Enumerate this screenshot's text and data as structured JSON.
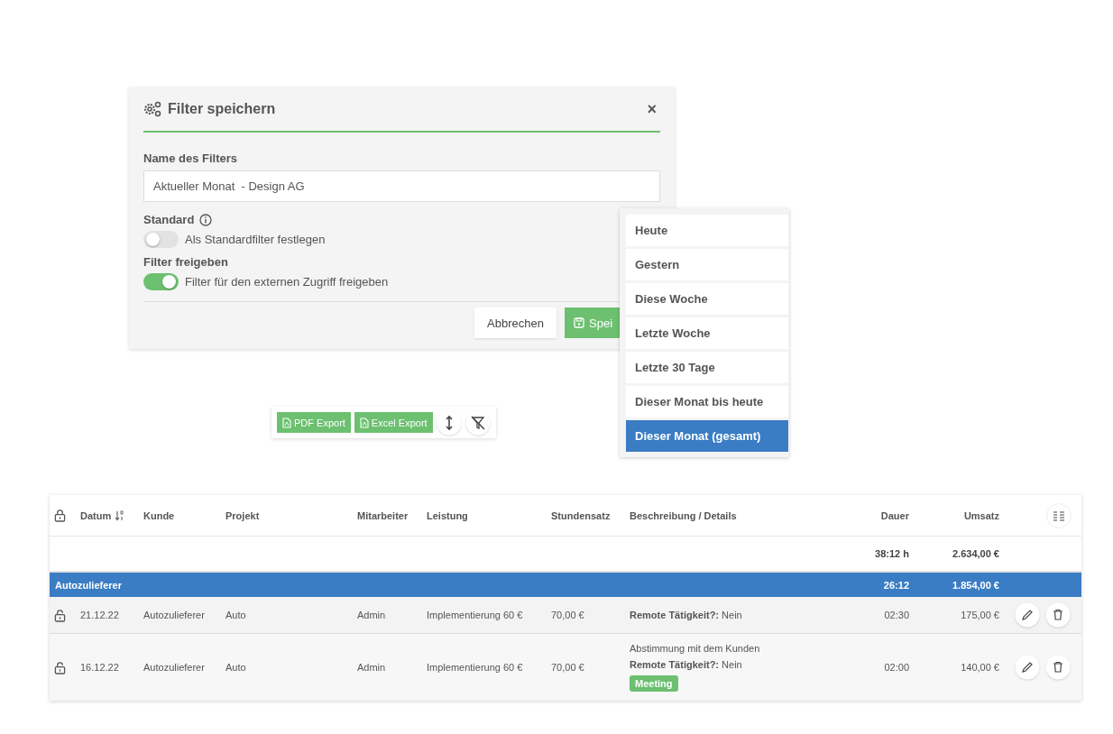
{
  "dialog": {
    "title": "Filter speichern",
    "close": "×",
    "name_label": "Name des Filters",
    "name_value": "Aktueller Monat  - Design AG",
    "toggles": [
      {
        "label": "Standard",
        "info": true,
        "text": "Als Standardfilter festlegen",
        "on": false
      },
      {
        "label": "Filter freigeben",
        "info": false,
        "text": "Filter für den externen Zugriff freigeben",
        "on": true
      }
    ],
    "cancel": "Abbrechen",
    "save": "Spei"
  },
  "period_menu": [
    {
      "label": "Heute",
      "selected": false
    },
    {
      "label": "Gestern",
      "selected": false
    },
    {
      "label": "Diese Woche",
      "selected": false
    },
    {
      "label": "Letzte Woche",
      "selected": false
    },
    {
      "label": "Letzte 30 Tage",
      "selected": false
    },
    {
      "label": "Dieser Monat bis heute",
      "selected": false
    },
    {
      "label": "Dieser Monat (gesamt)",
      "selected": true
    }
  ],
  "toolbar": {
    "buttons": [
      "PDF Export",
      "Excel Export"
    ]
  },
  "table": {
    "columns": [
      "Datum",
      "Kunde",
      "Projekt",
      "Mitarbeiter",
      "Leistung",
      "Stundensatz",
      "Beschreibung / Details",
      "Dauer",
      "Umsatz"
    ],
    "totals": {
      "duration": "38:12 h",
      "revenue": "2.634,00 €"
    },
    "group": {
      "name": "Autozulieferer",
      "duration": "26:12",
      "revenue": "1.854,00 €"
    },
    "rows": [
      {
        "locked": false,
        "date": "21.12.22",
        "customer": "Autozulieferer",
        "project": "Auto",
        "employee": "Admin",
        "service": "Implementierung 60 €",
        "rate": "70,00 €",
        "details": [
          "**Remote Tätigkeit?:** Nein"
        ],
        "tags": [],
        "duration": "02:30",
        "revenue": "175,00 €"
      },
      {
        "locked": false,
        "date": "16.12.22",
        "customer": "Autozulieferer",
        "project": "Auto",
        "employee": "Admin",
        "service": "Implementierung 60 €",
        "rate": "70,00 €",
        "details": [
          "Abstimmung mit dem Kunden",
          "**Remote Tätigkeit?:** Nein"
        ],
        "tags": [
          {
            "label": "Meeting",
            "color": "#6cc070"
          }
        ],
        "duration": "02:00",
        "revenue": "140,00 €"
      }
    ]
  }
}
